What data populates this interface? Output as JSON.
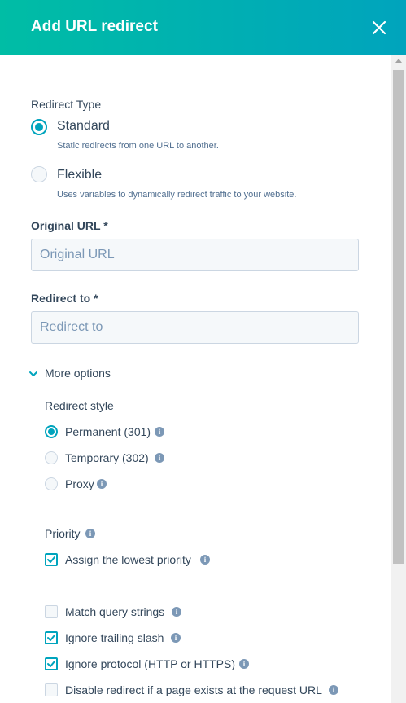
{
  "header": {
    "title": "Add URL redirect",
    "close_icon": "close-icon",
    "gradient_start": "#00bda5",
    "gradient_end": "#00a4bd"
  },
  "redirect_type": {
    "label": "Redirect Type",
    "options": [
      {
        "label": "Standard",
        "help": "Static redirects from one URL to another.",
        "selected": true
      },
      {
        "label": "Flexible",
        "help": "Uses variables to dynamically redirect traffic to your website.",
        "selected": false
      }
    ]
  },
  "original_url": {
    "label": "Original URL *",
    "placeholder": "Original URL",
    "value": ""
  },
  "redirect_to": {
    "label": "Redirect to *",
    "placeholder": "Redirect to",
    "value": ""
  },
  "more_options": {
    "label": "More options",
    "expanded": true,
    "redirect_style": {
      "label": "Redirect style",
      "options": [
        {
          "label": "Permanent (301)",
          "selected": true
        },
        {
          "label": "Temporary (302)",
          "selected": false
        },
        {
          "label": "Proxy",
          "selected": false
        }
      ]
    },
    "priority": {
      "label": "Priority",
      "checkbox": {
        "label": "Assign the lowest priority",
        "checked": true
      }
    },
    "checkboxes": [
      {
        "label": "Match query strings",
        "checked": false
      },
      {
        "label": "Ignore trailing slash",
        "checked": true
      },
      {
        "label": "Ignore protocol (HTTP or HTTPS)",
        "checked": true
      },
      {
        "label": "Disable redirect if a page exists at the request URL",
        "checked": false
      }
    ]
  },
  "colors": {
    "accent": "#00a4bd",
    "text": "#33475b",
    "input_bg": "#f5f8fa",
    "border": "#cbd6e2",
    "info_icon": "#7c98b6"
  }
}
